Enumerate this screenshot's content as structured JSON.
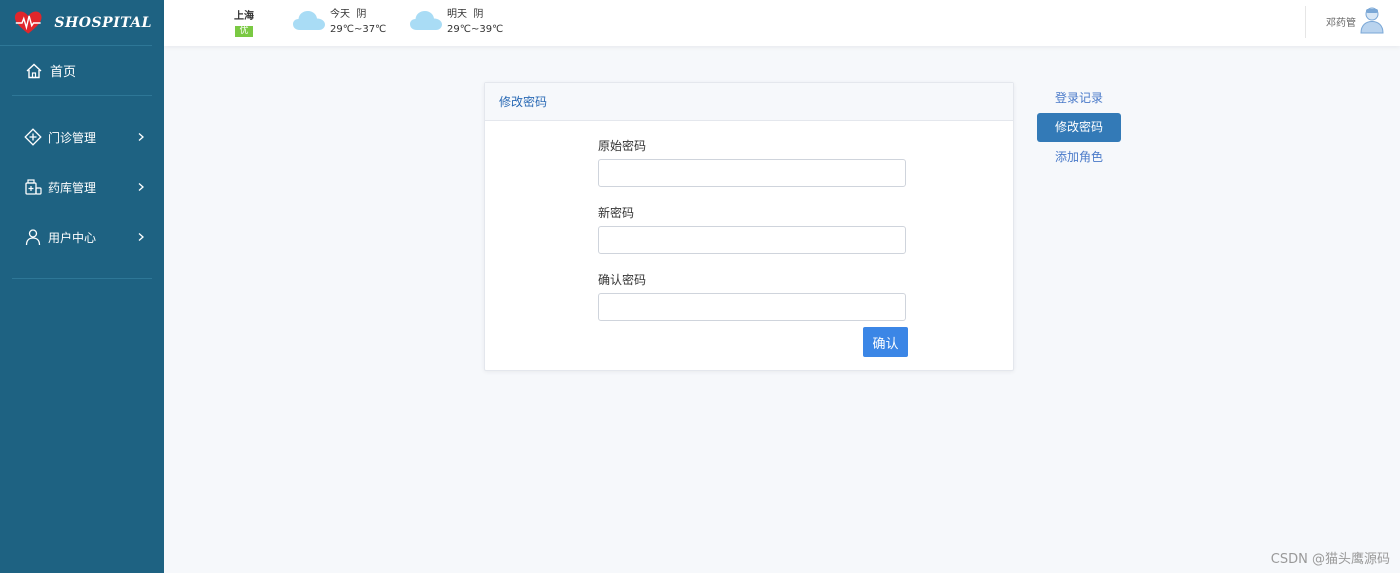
{
  "brand": {
    "name": "SHOSPITAL"
  },
  "nav": {
    "home_label": "首页",
    "items": [
      {
        "label": "门诊管理",
        "icon": "clinic-icon"
      },
      {
        "label": "药库管理",
        "icon": "pharmacy-icon"
      },
      {
        "label": "用户中心",
        "icon": "user-icon"
      }
    ]
  },
  "header": {
    "city": "上海",
    "aqi": "优",
    "today": {
      "day": "今天",
      "condition": "阴",
      "temp": "29℃~37℃"
    },
    "tomorrow": {
      "day": "明天",
      "condition": "阴",
      "temp": "29℃~39℃"
    },
    "username": "邓药管"
  },
  "card": {
    "title": "修改密码",
    "fields": [
      {
        "label": "原始密码",
        "value": ""
      },
      {
        "label": "新密码",
        "value": ""
      },
      {
        "label": "确认密码",
        "value": ""
      }
    ],
    "confirm_label": "确认"
  },
  "side_menu": {
    "items": [
      {
        "label": "登录记录",
        "active": false
      },
      {
        "label": "修改密码",
        "active": true
      },
      {
        "label": "添加角色",
        "active": false
      }
    ]
  },
  "watermark": "CSDN @猫头鹰源码",
  "colors": {
    "sidebar": "#1e6282",
    "accent": "#3b86e6",
    "active_menu": "#337ab7",
    "aqi_good": "#7ac943"
  }
}
